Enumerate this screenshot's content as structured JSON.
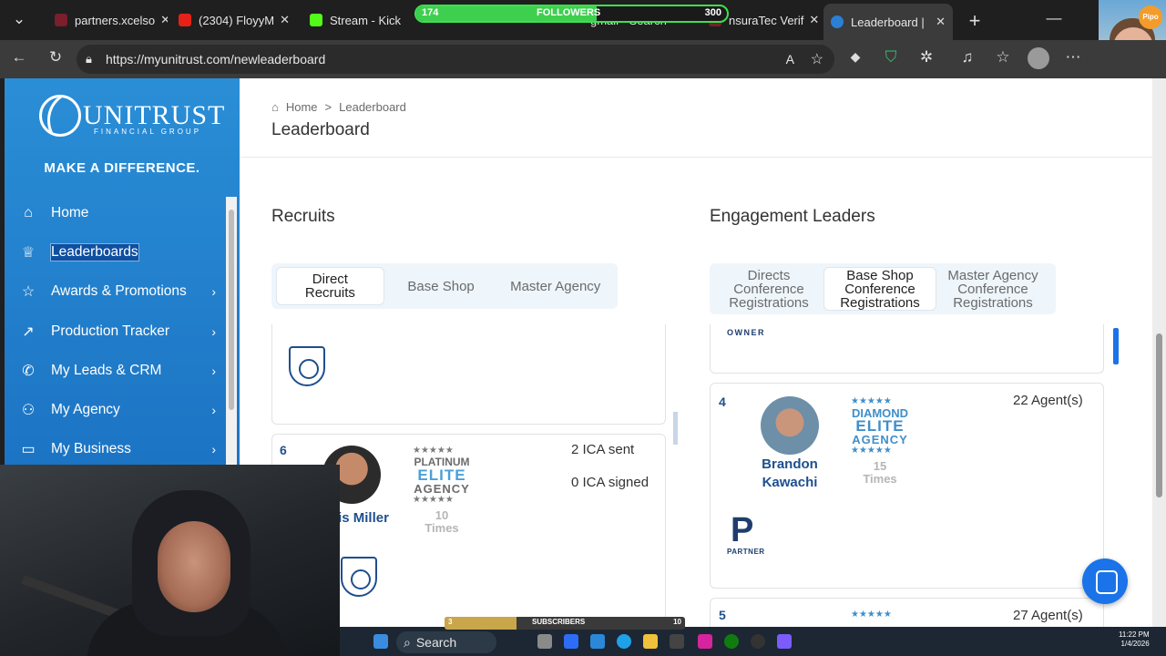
{
  "browser": {
    "tabs": [
      {
        "label": "partners.xcelso",
        "color": "#7a1f2b"
      },
      {
        "label": "(2304) FloyyM",
        "color": "#e62117"
      },
      {
        "label": "Stream - Kick",
        "color": "#53fc18"
      },
      {
        "label": "gmail - Search",
        "color": "#8a8a8a"
      },
      {
        "label": "nsuraTec Verif",
        "color": "#7a1f2b"
      },
      {
        "label": "Leaderboard |",
        "color": "#2b7fd4"
      }
    ],
    "url": "https://myunitrust.com/newleaderboard"
  },
  "overlay": {
    "followers_label": "FOLLOWERS",
    "followers_current": "174",
    "followers_goal": "300",
    "followers_progress": 0.58,
    "subscribers_label": "SUBSCRIBERS",
    "subscribers_current": "3",
    "subscribers_goal": "10",
    "subscribers_progress": 0.3,
    "sticker_text": "Pipo"
  },
  "sidebar": {
    "brand": "UNITRUST",
    "brand_sub": "FINANCIAL GROUP",
    "tagline": "MAKE A DIFFERENCE.",
    "items": [
      {
        "label": "Home",
        "icon": "home-icon",
        "glyph": "⌂",
        "has_chevron": false
      },
      {
        "label": "Leaderboards",
        "icon": "trophy-icon",
        "glyph": "♕",
        "has_chevron": false
      },
      {
        "label": "Awards & Promotions",
        "icon": "star-icon",
        "glyph": "☆",
        "has_chevron": true
      },
      {
        "label": "Production Tracker",
        "icon": "chart-icon",
        "glyph": "↗",
        "has_chevron": true
      },
      {
        "label": "My Leads & CRM",
        "icon": "phone-icon",
        "glyph": "✆",
        "has_chevron": true
      },
      {
        "label": "My Agency",
        "icon": "people-icon",
        "glyph": "⚇",
        "has_chevron": true
      },
      {
        "label": "My Business",
        "icon": "briefcase-icon",
        "glyph": "▭",
        "has_chevron": true
      }
    ]
  },
  "breadcrumb": {
    "home": "Home",
    "sep": ">",
    "current": "Leaderboard"
  },
  "page_title": "Leaderboard",
  "recruits": {
    "title": "Recruits",
    "tabs": [
      "Direct Recruits",
      "Base Shop",
      "Master Agency"
    ],
    "entry": {
      "rank": "6",
      "name": "is Miller",
      "tier_top": "PLATINUM",
      "tier_mid": "ELITE",
      "tier_bot": "AGENCY",
      "times_n": "10",
      "times_label": "Times",
      "sent": "2 ICA sent",
      "signed": "0 ICA signed"
    }
  },
  "engagement": {
    "title": "Engagement Leaders",
    "tabs": [
      "Directs Conference Registrations",
      "Base Shop Conference Registrations",
      "Master Agency Conference Registrations"
    ],
    "owner_label": "OWNER",
    "entry": {
      "rank": "4",
      "first": "Brandon",
      "last": "Kawachi",
      "tier_top": "DIAMOND",
      "tier_mid": "ELITE",
      "tier_bot": "AGENCY",
      "times_n": "15",
      "times_label": "Times",
      "agents": "22  Agent(s)",
      "partner_letter": "P",
      "partner_label": "PARTNER"
    },
    "next": {
      "rank": "5",
      "agents": "27  Agent(s)"
    }
  },
  "taskbar": {
    "search": "Search",
    "time": "11:22 PM",
    "date": "1/4/2026"
  }
}
